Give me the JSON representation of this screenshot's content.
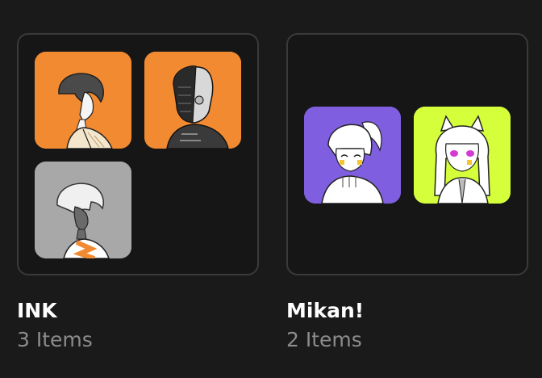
{
  "collections": [
    {
      "title": "INK",
      "count": "3 Items",
      "thumbnails": [
        {
          "bg": "#f28a31",
          "icon": "profile-woman-kimono-icon"
        },
        {
          "bg": "#f28a31",
          "icon": "profile-cyborg-man-icon"
        },
        {
          "bg": "#a8a8a8",
          "icon": "profile-short-hair-woman-icon"
        }
      ]
    },
    {
      "title": "Mikan!",
      "count": "2 Items",
      "thumbnails": [
        {
          "bg": "#7f5fe0",
          "icon": "anime-ponytail-girl-icon"
        },
        {
          "bg": "#d4ff3a",
          "icon": "anime-cat-ears-girl-icon"
        }
      ]
    }
  ]
}
